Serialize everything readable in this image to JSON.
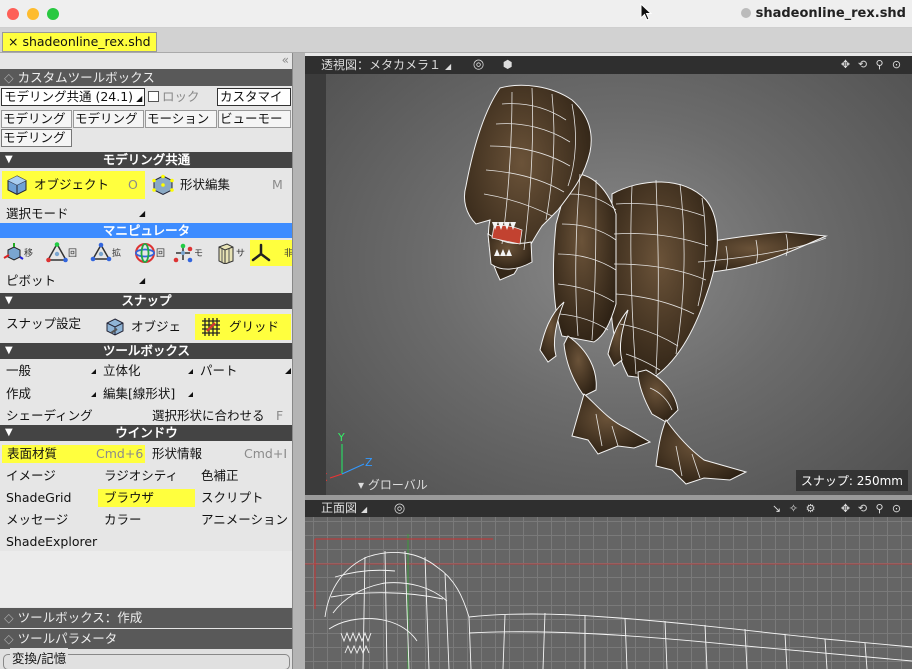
{
  "window": {
    "title": "shadeonline_rex.shd"
  },
  "tab": {
    "label": "× shadeonline_rex.shd"
  },
  "palette": {
    "custom_toolbox_title": "カスタムツールボックス",
    "preset_dropdown": "モデリング共通 (24.1)",
    "lock_label": "ロック",
    "customize_button": "カスタマイ",
    "mode_tabs": [
      "モデリング",
      "モデリング",
      "モーション",
      "ビューモー",
      "モデリング"
    ],
    "section_modeling_common": "モデリング共通",
    "object_button": "オブジェクト",
    "object_shortcut": "O",
    "shape_edit_button": "形状編集",
    "shape_edit_shortcut": "M",
    "select_mode": "選択モード",
    "manipulator_header": "マニピュレータ",
    "manipulator_labels": [
      "移",
      "回",
      "拡",
      "回",
      "モ",
      "サ",
      "非"
    ],
    "pivot": "ピボット",
    "section_snap": "スナップ",
    "snap_settings": "スナップ設定",
    "snap_object": "オブジェ",
    "snap_grid": "グリッド",
    "section_toolbox": "ツールボックス",
    "toolbox_general": "一般",
    "toolbox_solid": "立体化",
    "toolbox_part": "パート",
    "toolbox_create": "作成",
    "toolbox_edit_line": "編集[線形状]",
    "shading": "シェーディング",
    "fit_selected": "選択形状に合わせる",
    "fit_selected_shortcut": "F",
    "section_window": "ウインドウ",
    "window_items": [
      {
        "label": "表面材質",
        "shortcut": "Cmd+6"
      },
      {
        "label": "形状情報",
        "shortcut": "Cmd+I"
      },
      {
        "label": "イメージ",
        "shortcut": ""
      },
      {
        "label": "ラジオシティ",
        "shortcut": ""
      },
      {
        "label": "色補正",
        "shortcut": ""
      },
      {
        "label": "ShadeGrid",
        "shortcut": ""
      },
      {
        "label": "ブラウザ",
        "shortcut": ""
      },
      {
        "label": "スクリプト",
        "shortcut": ""
      },
      {
        "label": "メッセージ",
        "shortcut": ""
      },
      {
        "label": "カラー",
        "shortcut": ""
      },
      {
        "label": "アニメーション",
        "shortcut": ""
      },
      {
        "label": "ShadeExplorer",
        "shortcut": ""
      }
    ],
    "toolbox_create_title": "ツールボックス：作成",
    "tool_params_title": "ツールパラメータ",
    "transform_memory": "変換/記憶"
  },
  "viewports": {
    "perspective": {
      "title": "透視図：メタカメラ１",
      "snap_status": "スナップ: 250mm",
      "global_label": "▾ グローバル",
      "axis_labels": [
        "Y",
        "Z",
        "X"
      ]
    },
    "front": {
      "title": "正面図"
    }
  },
  "colors": {
    "highlight": "#ffff3e",
    "manipulator_blue": "#3d8cff",
    "section_dark": "#444444"
  }
}
